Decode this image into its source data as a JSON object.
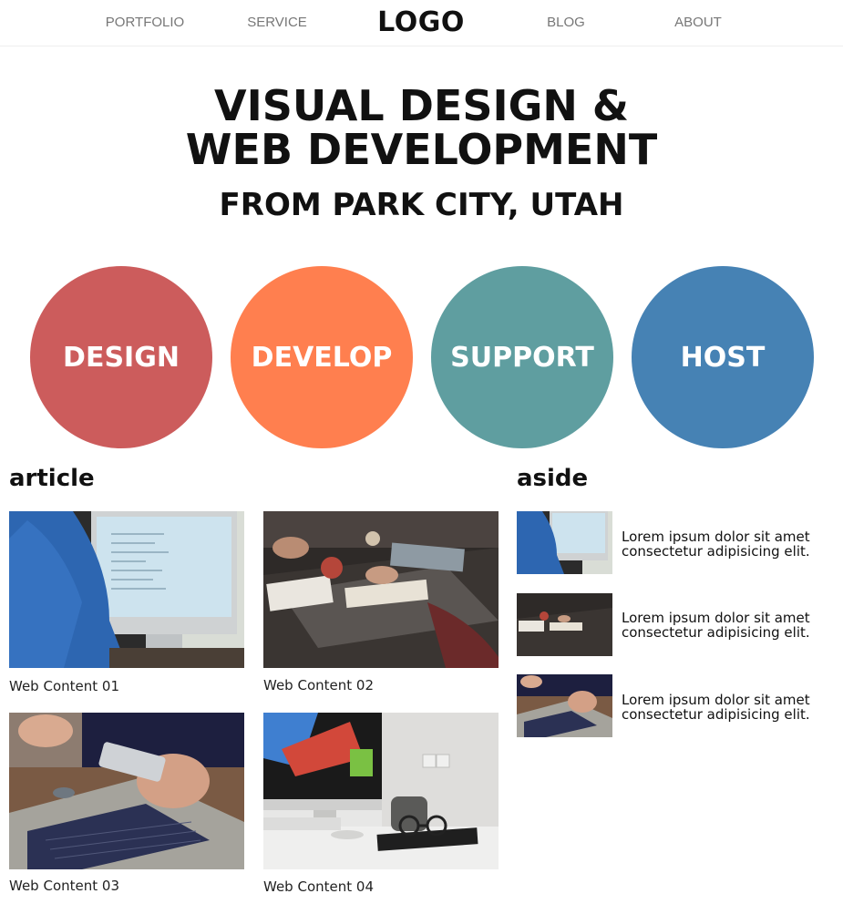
{
  "nav": {
    "portfolio": "PORTFOLIO",
    "service": "SERVICE",
    "logo": "LOGO",
    "blog": "BLOG",
    "about": "ABOUT"
  },
  "hero": {
    "title": "VISUAL DESIGN & WEB DEVELOPMENT",
    "subtitle": "FROM PARK CITY, UTAH"
  },
  "services": [
    {
      "label": "DESIGN",
      "color": "#cc5c5c"
    },
    {
      "label": "DEVELOP",
      "color": "#ff7f4f"
    },
    {
      "label": "SUPPORT",
      "color": "#5f9ea0"
    },
    {
      "label": "HOST",
      "color": "#4682b4"
    }
  ],
  "article": {
    "heading": "article",
    "cards": [
      {
        "caption": "Web Content 01"
      },
      {
        "caption": "Web Content 02"
      },
      {
        "caption": "Web Content 03"
      },
      {
        "caption": "Web Content 04"
      }
    ]
  },
  "aside": {
    "heading": "aside",
    "items": [
      {
        "text": "Lorem ipsum dolor sit amet consectetur adipisicing elit."
      },
      {
        "text": "Lorem ipsum dolor sit amet consectetur adipisicing elit."
      },
      {
        "text": "Lorem ipsum dolor sit amet consectetur adipisicing elit."
      }
    ]
  }
}
